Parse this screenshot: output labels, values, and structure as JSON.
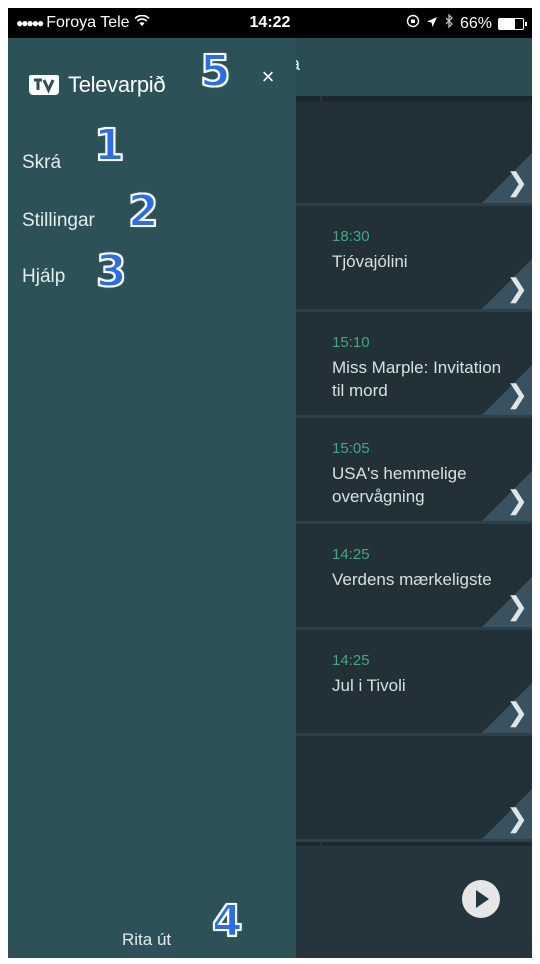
{
  "status_bar": {
    "signal_dots": "●●●●●",
    "carrier": "Foroya Tele",
    "wifi_icon": "wifi-icon",
    "time": "14:22",
    "battery_percent": "66%",
    "battery_level": 0.66
  },
  "drawer": {
    "brand": "Televarpið",
    "close_label": "×",
    "menu": [
      {
        "label": "Skrá"
      },
      {
        "label": "Stillingar"
      },
      {
        "label": "Hjálp"
      }
    ],
    "logout_label": "Rita út"
  },
  "background": {
    "header_fragment": "a",
    "programs": [
      {
        "time": "",
        "title": ""
      },
      {
        "time": "18:30",
        "title": "Tjóvajólini"
      },
      {
        "time": "15:10",
        "title": "Miss Marple: Invitation til mord"
      },
      {
        "time": "15:05",
        "title": "USA's hemmelige overvågning"
      },
      {
        "time": "14:25",
        "title": "Verdens mærkeligste"
      },
      {
        "time": "14:25",
        "title": "Jul i Tivoli"
      },
      {
        "time": "",
        "title": ""
      }
    ],
    "chevron": "❯"
  },
  "annotations": [
    "1",
    "2",
    "3",
    "4",
    "5"
  ],
  "colors": {
    "drawer_bg": "#2c5257",
    "accent_time": "#3ea88a",
    "badge": "#2a6cf0"
  }
}
